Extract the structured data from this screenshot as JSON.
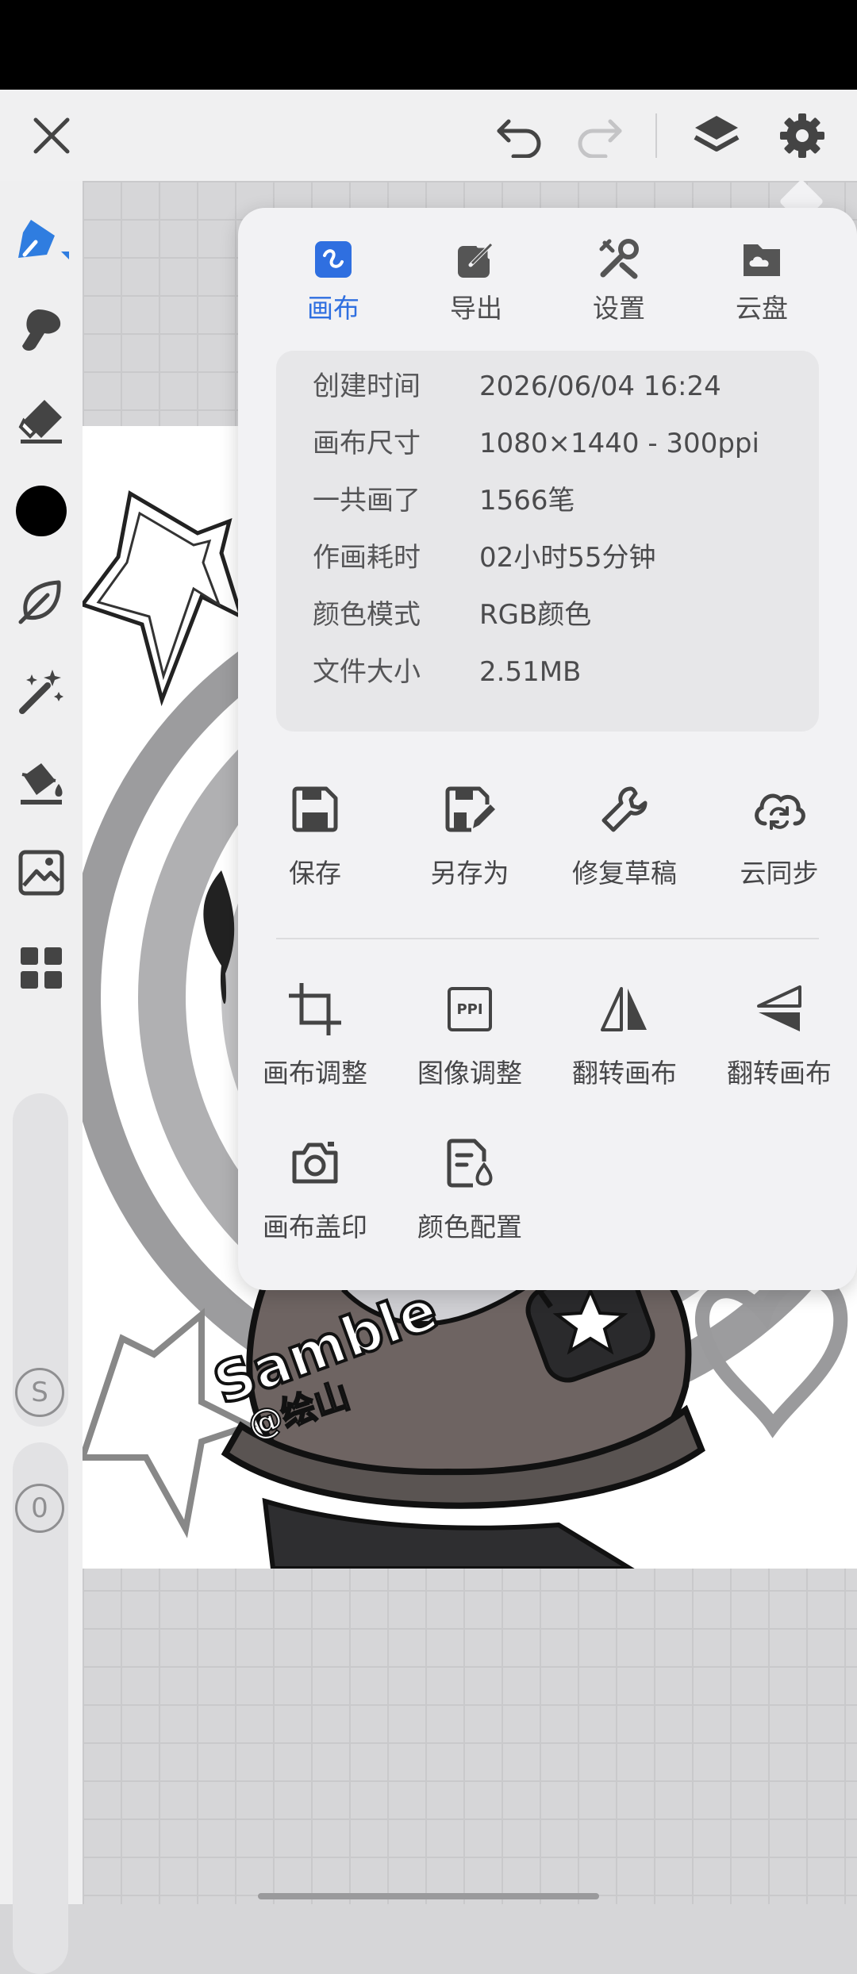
{
  "topbar": {
    "close_icon": "close-icon",
    "undo_icon": "undo-icon",
    "redo_icon": "redo-icon",
    "layers_icon": "layers-icon",
    "settings_icon": "gear-icon"
  },
  "toolbar": {
    "tools": [
      "brush-icon",
      "smudge-icon",
      "eraser-icon",
      "color-swatch",
      "leaf-icon",
      "magic-wand-icon",
      "fill-bucket-icon",
      "image-import-icon",
      "grid-menu-icon"
    ],
    "size_badge": "S",
    "opacity_badge": "0"
  },
  "popover": {
    "tabs": [
      {
        "label": "画布",
        "icon": "canvas-icon",
        "active": true
      },
      {
        "label": "导出",
        "icon": "export-icon",
        "active": false
      },
      {
        "label": "设置",
        "icon": "tools-icon",
        "active": false
      },
      {
        "label": "云盘",
        "icon": "cloud-drive-icon",
        "active": false
      }
    ],
    "info": [
      {
        "key": "创建时间",
        "value": "2026/06/04 16:24"
      },
      {
        "key": "画布尺寸",
        "value": "1080×1440 - 300ppi"
      },
      {
        "key": "一共画了",
        "value": "1566笔"
      },
      {
        "key": "作画耗时",
        "value": "02小时55分钟"
      },
      {
        "key": "颜色模式",
        "value": "RGB颜色"
      },
      {
        "key": "文件大小",
        "value": "2.51MB"
      }
    ],
    "actions_row1": [
      {
        "label": "保存",
        "icon": "save-icon"
      },
      {
        "label": "另存为",
        "icon": "save-as-icon"
      },
      {
        "label": "修复草稿",
        "icon": "wrench-icon"
      },
      {
        "label": "云同步",
        "icon": "cloud-sync-icon"
      }
    ],
    "actions_row2": [
      {
        "label": "画布调整",
        "icon": "crop-icon"
      },
      {
        "label": "图像调整",
        "icon": "ppi-icon"
      },
      {
        "label": "翻转画布",
        "icon": "flip-horizontal-icon"
      },
      {
        "label": "翻转画布",
        "icon": "flip-vertical-icon"
      }
    ],
    "actions_row3": [
      {
        "label": "画布盖印",
        "icon": "camera-icon"
      },
      {
        "label": "颜色配置",
        "icon": "color-config-icon"
      }
    ],
    "ppi_icon_text": "PPI"
  },
  "artwork": {
    "watermark_text": "Samble",
    "watermark_handle": "@绘山"
  },
  "colors": {
    "accent": "#2f6fe0",
    "current_color": "#000000",
    "popover_bg": "#f2f2f4",
    "info_card_bg": "#e7e7e9"
  }
}
